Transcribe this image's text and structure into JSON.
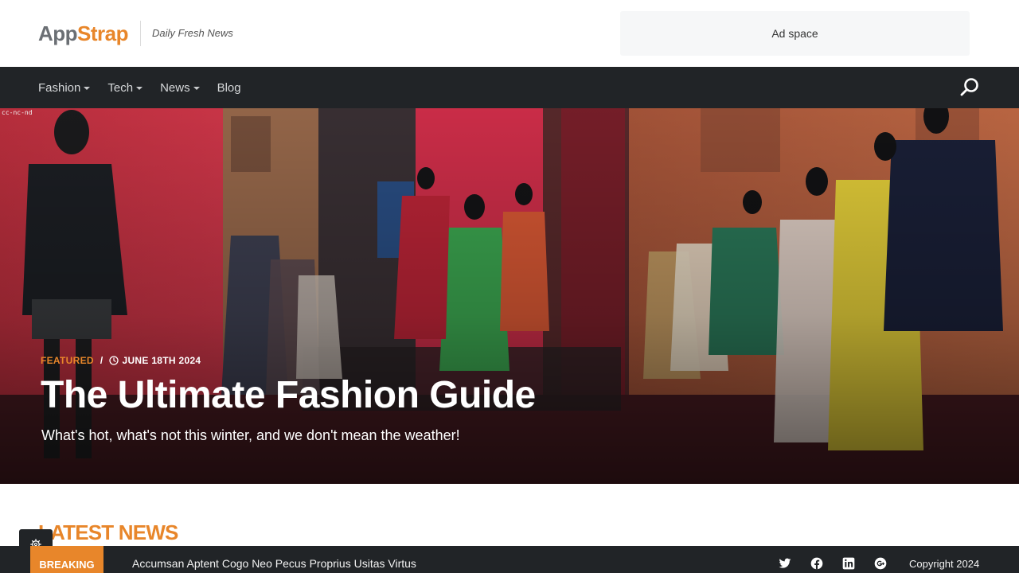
{
  "header": {
    "logo_part1": "App",
    "logo_part2": "Strap",
    "tagline": "Daily Fresh News",
    "ad_space": "Ad space"
  },
  "nav": {
    "items": [
      {
        "label": "Fashion",
        "dropdown": true
      },
      {
        "label": "Tech",
        "dropdown": true
      },
      {
        "label": "News",
        "dropdown": true
      },
      {
        "label": "Blog",
        "dropdown": false
      }
    ],
    "search_icon": "search-icon"
  },
  "hero": {
    "license": "cc-nc-nd",
    "category": "FEATURED",
    "separator": "/",
    "date": "JUNE 18TH 2024",
    "title": "The Ultimate Fashion Guide",
    "subtitle": "What's hot, what's not this winter, and we don't mean the weather!"
  },
  "latest_news": {
    "heading": "LATEST NEWS"
  },
  "footer": {
    "breaking_label": "BREAKING",
    "ticker_text": "Accumsan Aptent Cogo Neo Pecus Proprius Usitas Virtus",
    "social_icons": [
      "twitter-icon",
      "facebook-icon",
      "linkedin-icon",
      "google-plus-icon"
    ],
    "copyright": "Copyright 2024"
  },
  "colors": {
    "accent": "#e8862a",
    "dark": "#212427",
    "logo_gray": "#6b6f74"
  }
}
